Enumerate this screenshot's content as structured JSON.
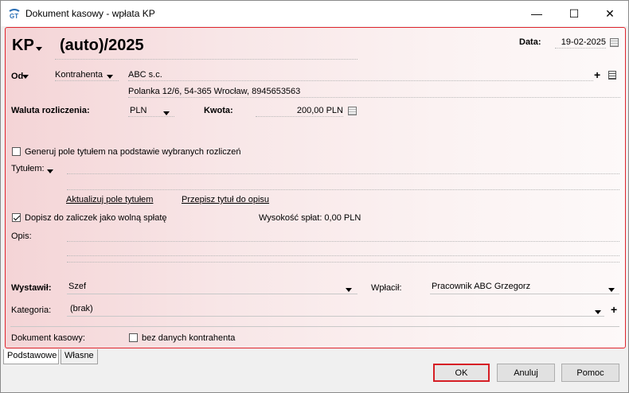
{
  "window": {
    "title": "Dokument kasowy - wpłata KP",
    "minimize": "—",
    "maximize": "☐",
    "close": "✕"
  },
  "header": {
    "doc_type": "KP",
    "doc_number": "(auto)/2025",
    "date_label": "Data:",
    "date_value": "19-02-2025"
  },
  "counterparty": {
    "label": "Od",
    "type": "Kontrahenta",
    "name": "ABC s.c.",
    "address": "Polanka  12/6, 54-365 Wrocław, 8945653563",
    "add": "+"
  },
  "currency": {
    "label": "Waluta rozliczenia:",
    "value": "PLN",
    "amount_label": "Kwota:",
    "amount_value": "200,00 PLN"
  },
  "title_section": {
    "generate_label": "Generuj pole tytułem na podstawie wybranych rozliczeń",
    "title_label": "Tytułem:",
    "update_link": "Aktualizuj pole tytułem",
    "copy_link": "Przepisz tytuł do opisu",
    "advance_label": "Dopisz do zaliczek jako wolną spłatę",
    "payment_amount": "Wysokość spłat: 0,00 PLN",
    "description_label": "Opis:"
  },
  "issued": {
    "label": "Wystawił:",
    "value": "Szef",
    "paid_label": "Wpłacił:",
    "paid_value": "Pracownik ABC Grzegorz"
  },
  "category": {
    "label": "Kategoria:",
    "value": "(brak)",
    "add": "+"
  },
  "cash_doc": {
    "label": "Dokument kasowy:",
    "checkbox_label": "bez danych kontrahenta"
  },
  "tabs": [
    {
      "label": "Podstawowe"
    },
    {
      "label": "Własne"
    }
  ],
  "buttons": {
    "ok": "OK",
    "cancel": "Anuluj",
    "help": "Pomoc"
  },
  "colors": {
    "accent": "#e0262e"
  }
}
